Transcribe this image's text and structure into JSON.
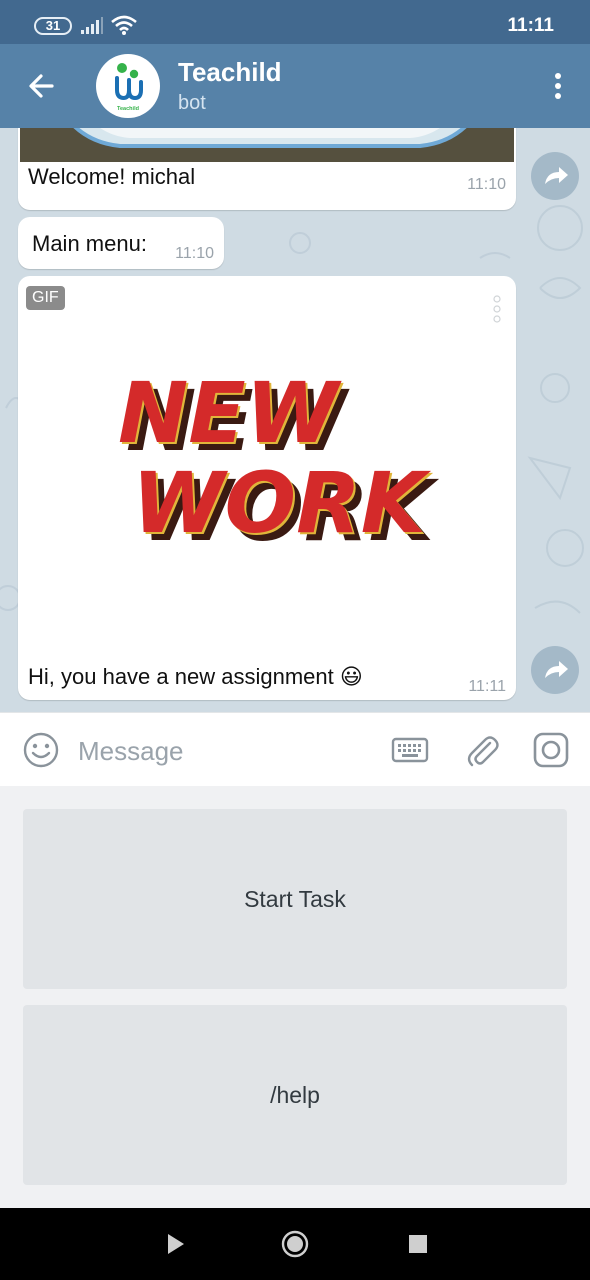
{
  "status_bar": {
    "battery": "31",
    "time": "11:11"
  },
  "header": {
    "title": "Teachild",
    "subtitle": "bot",
    "logo_text": "Teachild"
  },
  "messages": [
    {
      "text": "Welcome! michal",
      "time": "11:10"
    },
    {
      "text": "Main menu:",
      "time": "11:10"
    },
    {
      "badge": "GIF",
      "text": "Hi, you have a new assignment 😃",
      "time": "11:11",
      "gif_line1": "NEW",
      "gif_line2": "WORK"
    }
  ],
  "composer": {
    "placeholder": "Message"
  },
  "keyboard": {
    "buttons": [
      "Start Task",
      "/help"
    ]
  },
  "colors": {
    "header": "#5682a8",
    "status_bar": "#42698f",
    "chat_bg": "#cfdbe3"
  }
}
